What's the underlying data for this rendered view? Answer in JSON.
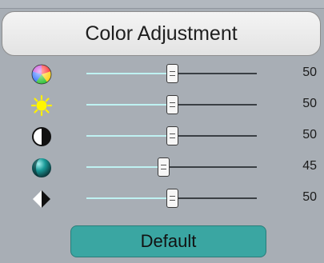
{
  "panel": {
    "title": "Color Adjustment"
  },
  "controls": [
    {
      "name": "hue",
      "icon": "color-wheel-icon",
      "value": 50,
      "label": "50"
    },
    {
      "name": "brightness",
      "icon": "sun-icon",
      "value": 50,
      "label": "50"
    },
    {
      "name": "contrast",
      "icon": "contrast-icon",
      "value": 50,
      "label": "50"
    },
    {
      "name": "saturation",
      "icon": "teal-sphere-icon",
      "value": 45,
      "label": "45"
    },
    {
      "name": "sharpness",
      "icon": "half-diamond-icon",
      "value": 50,
      "label": "50"
    }
  ],
  "default_button": {
    "label": "Default"
  }
}
